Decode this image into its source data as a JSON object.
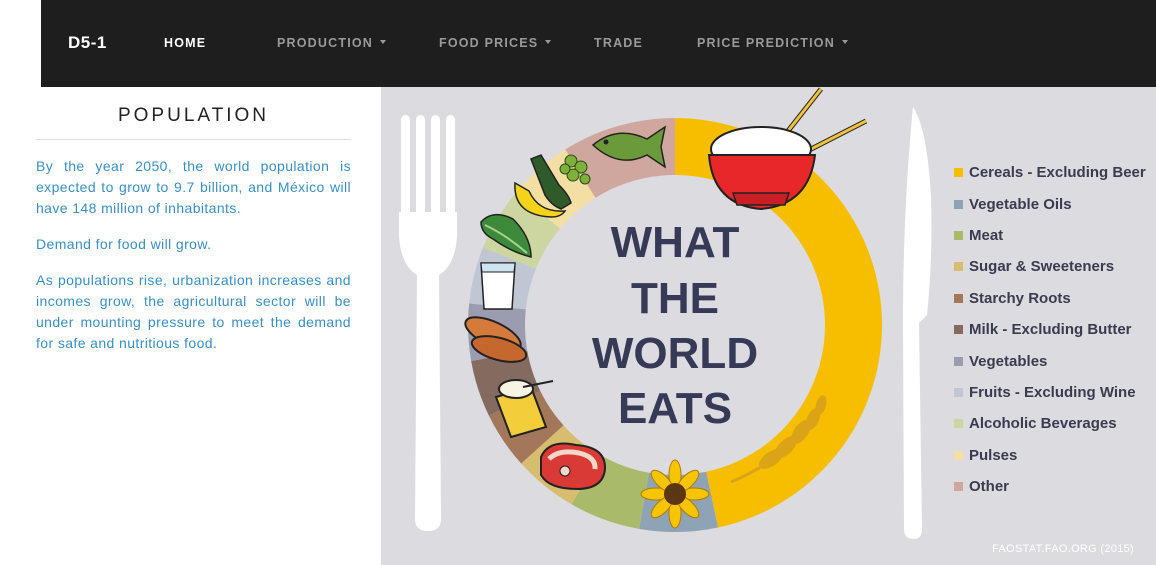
{
  "navbar": {
    "brand": "D5-1",
    "items": [
      {
        "label": "HOME",
        "active": true,
        "dropdown": false
      },
      {
        "label": "PRODUCTION",
        "active": false,
        "dropdown": true
      },
      {
        "label": "FOOD PRICES",
        "active": false,
        "dropdown": true
      },
      {
        "label": "TRADE",
        "active": false,
        "dropdown": false
      },
      {
        "label": "PRICE PREDICTION",
        "active": false,
        "dropdown": true
      }
    ]
  },
  "population": {
    "title": "POPULATION",
    "paragraphs": [
      "By the year 2050, the world population is expected to grow to 9.7 billion, and México will have 148 million of inhabitants.",
      "Demand for food will grow.",
      "As populations rise, urbanization increases and incomes grow, the agricultural sector will be under mounting pressure to meet the demand for safe and nutritious food."
    ]
  },
  "infographic": {
    "title_lines": [
      "WHAT",
      "THE",
      "WORLD",
      "EATS"
    ],
    "source": "FAOSTAT.FAO.ORG (2015)",
    "legend": [
      {
        "label": "Cereals - Excluding Beer",
        "color": "#f7be00"
      },
      {
        "label": "Vegetable Oils",
        "color": "#8ea3b4"
      },
      {
        "label": "Meat",
        "color": "#a9ba6a"
      },
      {
        "label": "Sugar & Sweeteners",
        "color": "#d7bd70"
      },
      {
        "label": "Starchy Roots",
        "color": "#a3785a"
      },
      {
        "label": "Milk - Excluding Butter",
        "color": "#856b5f"
      },
      {
        "label": "Vegetables",
        "color": "#9b9caf"
      },
      {
        "label": "Fruits - Excluding Wine",
        "color": "#c0c6d2"
      },
      {
        "label": "Alcoholic Beverages",
        "color": "#cdd5a0"
      },
      {
        "label": "Pulses",
        "color": "#f3dfa4"
      },
      {
        "label": "Other",
        "color": "#cfa79f"
      }
    ],
    "icons": [
      "rice-bowl-icon",
      "wheat-icon",
      "sunflower-icon",
      "steak-icon",
      "butter-icon",
      "sweet-potato-icon",
      "milk-glass-icon",
      "lettuce-icon",
      "banana-icon",
      "wine-bottle-icon",
      "peas-icon",
      "fish-icon",
      "fork-icon",
      "knife-icon"
    ]
  }
}
